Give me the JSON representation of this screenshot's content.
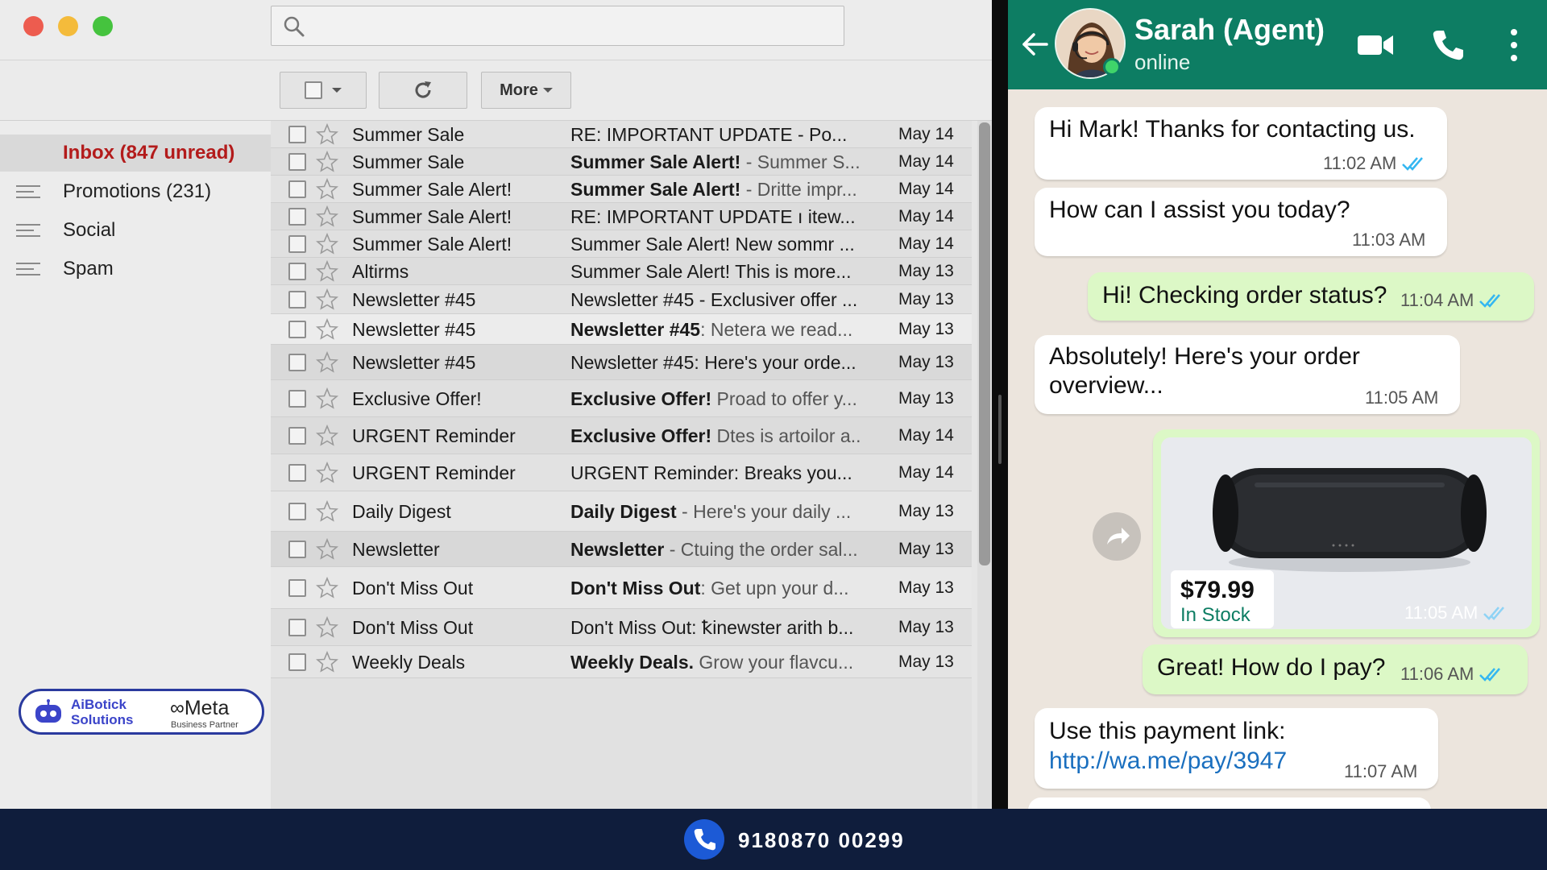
{
  "mail": {
    "search": {
      "placeholder": ""
    },
    "toolbar": {
      "more_label": "More"
    },
    "sidebar": {
      "items": [
        {
          "label": "Inbox (847 unread)",
          "active": true
        },
        {
          "label": "Promotions (231)"
        },
        {
          "label": "Social"
        },
        {
          "label": "Spam"
        }
      ]
    },
    "rows": [
      {
        "sender": "Summer Sale",
        "subject_bold": "",
        "subject": "RE: IMPORTANT UPDATE - Po...",
        "date": "May 14"
      },
      {
        "sender": "Summer Sale",
        "subject_bold": "Summer Sale Alert!",
        "subject": " - Summer S...",
        "date": "May 14"
      },
      {
        "sender": "Summer Sale Alert!",
        "subject_bold": "Summer Sale Alert!",
        "subject": " - Dritte impr...",
        "date": "May 14"
      },
      {
        "sender": "Summer Sale Alert!",
        "subject_bold": "",
        "subject": "RE: IMPORTANT UPDATE ı itew...",
        "date": "May 14"
      },
      {
        "sender": "Summer Sale Alert!",
        "subject_bold": "",
        "subject": "Summer Sale Alert! New sommr ...",
        "date": "May 14"
      },
      {
        "sender": "Altirms",
        "subject_bold": "",
        "subject": "Summer Sale Alert! This is more...",
        "date": "May 13"
      },
      {
        "sender": "Newsletter #45",
        "subject_bold": "",
        "subject": "Newsletter #45 - Exclusiver offer ...",
        "date": "May 13"
      },
      {
        "sender": "Newsletter #45",
        "subject_bold": "Newsletter #45",
        "subject": ": Netera we read...",
        "date": "May 13"
      },
      {
        "sender": "Newsletter #45",
        "subject_bold": "",
        "subject": "Newsletter #45: Here's your orde...",
        "date": "May 13"
      },
      {
        "sender": "Exclusive Offer!",
        "subject_bold": "Exclusive Offer!",
        "subject": " Proad to offer y...",
        "date": "May 13"
      },
      {
        "sender": "URGENT Reminder",
        "subject_bold": "Exclusive Offer!",
        "subject": " Dtes is artoilor a...",
        "date": "May 14"
      },
      {
        "sender": "URGENT Reminder",
        "subject_bold": "",
        "subject": "URGENT Reminder: Breaks you...",
        "date": "May 14"
      },
      {
        "sender": "Daily Digest",
        "subject_bold": "Daily Digest",
        "subject": " - Here's your daily ...",
        "date": "May 13"
      },
      {
        "sender": "Newsletter",
        "subject_bold": "Newsletter",
        "subject": " - Ctuing the order sal...",
        "date": "May 13"
      },
      {
        "sender": "Don't Miss Out",
        "subject_bold": "Don't Miss Out",
        "subject": ":  Get upn your d...",
        "date": "May 13"
      },
      {
        "sender": "Don't Miss Out",
        "subject_bold": "",
        "subject": "Don't Miss Out: ꝁinewster arith b...",
        "date": "May 13"
      },
      {
        "sender": "Weekly Deals",
        "subject_bold": "Weekly Deals.",
        "subject": " Grow your flavcu...",
        "date": "May 13"
      }
    ],
    "badge": {
      "brand": "AiBotick Solutions",
      "partner_brand": "Meta",
      "partner_sub": "Business Partner"
    }
  },
  "chat": {
    "contact_name": "Sarah (Agent)",
    "contact_status": "online",
    "messages": [
      {
        "dir": "in",
        "text": "Hi Mark! Thanks for contacting us.",
        "time": "11:02 AM",
        "ticks": true
      },
      {
        "dir": "in",
        "text": "How can I assist you today?",
        "time": "11:03 AM",
        "ticks": false
      },
      {
        "dir": "out",
        "text": "Hi! Checking order status?",
        "time": "11:04 AM",
        "ticks": true
      },
      {
        "dir": "in",
        "text_line1": "Absolutely! Here's your order",
        "text_line2": "overview...",
        "time": "11:05 AM",
        "ticks": false
      },
      {
        "dir": "out",
        "type": "product",
        "price": "$79.99",
        "stock": "In Stock",
        "time": "11:05 AM",
        "ticks": true
      },
      {
        "dir": "out",
        "text": "Great! How do I pay?",
        "time": "11:06 AM",
        "ticks": true
      },
      {
        "dir": "in",
        "text": "Use this payment link:",
        "link": "http://wa.me/pay/3947",
        "time": "11:07 AM",
        "ticks": false
      }
    ],
    "colors": {
      "header": "#0d7d63",
      "outgoing": "#dcf8c6",
      "incoming": "#ffffff",
      "tick": "#34b7f1"
    }
  },
  "footer": {
    "phone": "9180870 00299"
  }
}
